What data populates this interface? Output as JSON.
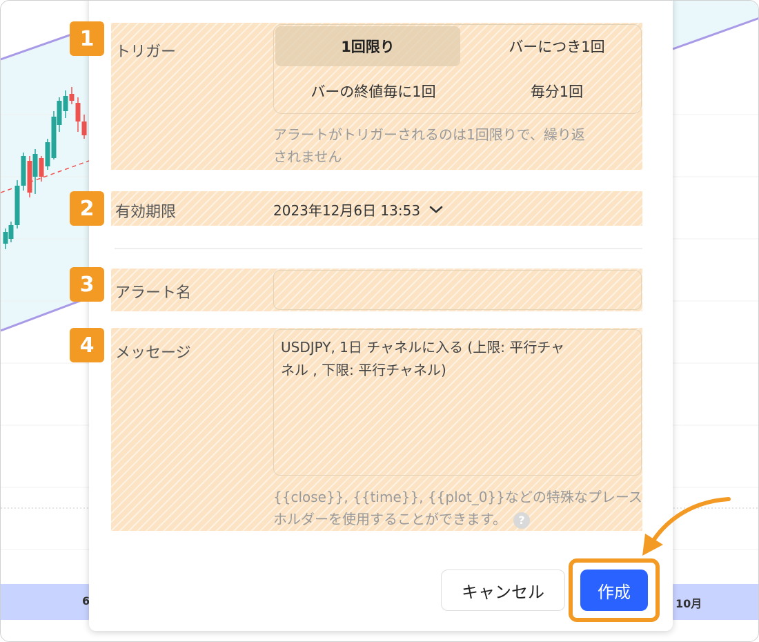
{
  "colors": {
    "accent_orange": "#f29a24",
    "highlight": "#fbe3c4",
    "primary_blue": "#2962ff",
    "channel_line": "#a99ae8",
    "candle_up": "#26a69a",
    "candle_down": "#ef5350"
  },
  "chart": {
    "time_labels": [
      "6",
      "10月"
    ]
  },
  "badges": [
    "1",
    "2",
    "3",
    "4"
  ],
  "trigger": {
    "label": "トリガー",
    "options": [
      "1回限り",
      "バーにつき1回",
      "バーの終値毎に1回",
      "毎分1回"
    ],
    "selected": "1回限り",
    "hint_line1": "アラートがトリガーされるのは1回限りで、繰り返",
    "hint_line2": "されません"
  },
  "expiry": {
    "label": "有効期限",
    "value": "2023年12月6日 13:53",
    "icon": "chevron-down-icon"
  },
  "alert_name": {
    "label": "アラート名",
    "value": "",
    "placeholder": ""
  },
  "message": {
    "label": "メッセージ",
    "line1": "USDJPY, 1日 チャネルに入る (上限: 平行チャ",
    "line2": "ネル , 下限: 平行チャネル)",
    "hint_line1": "{{close}}, {{time}}, {{plot_0}}などの特殊なプレース",
    "hint_line2": "ホルダーを使用することができます。",
    "info_icon_glyph": "?"
  },
  "buttons": {
    "cancel": "キャンセル",
    "create": "作成"
  }
}
